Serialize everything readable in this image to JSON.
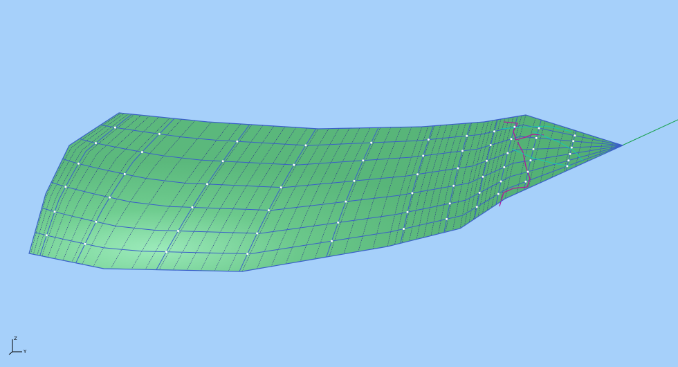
{
  "viewport": {
    "background": "#a6d0fa"
  },
  "model": {
    "surface_color": "#5fbf82",
    "highlight_color": "#a6f2c4",
    "shade_color": "#3f9c63",
    "edge_color": "#3a5fc8",
    "secondary_edge_color": "#2a2a8a",
    "node_color": "#ffffff",
    "feature_colors": [
      "#b0189c",
      "#18c8b0"
    ],
    "axis_line_color": "#16a04a"
  },
  "triad": {
    "z_label": "Z",
    "y_label": "Y",
    "icon": "coordinate-triad-icon"
  }
}
